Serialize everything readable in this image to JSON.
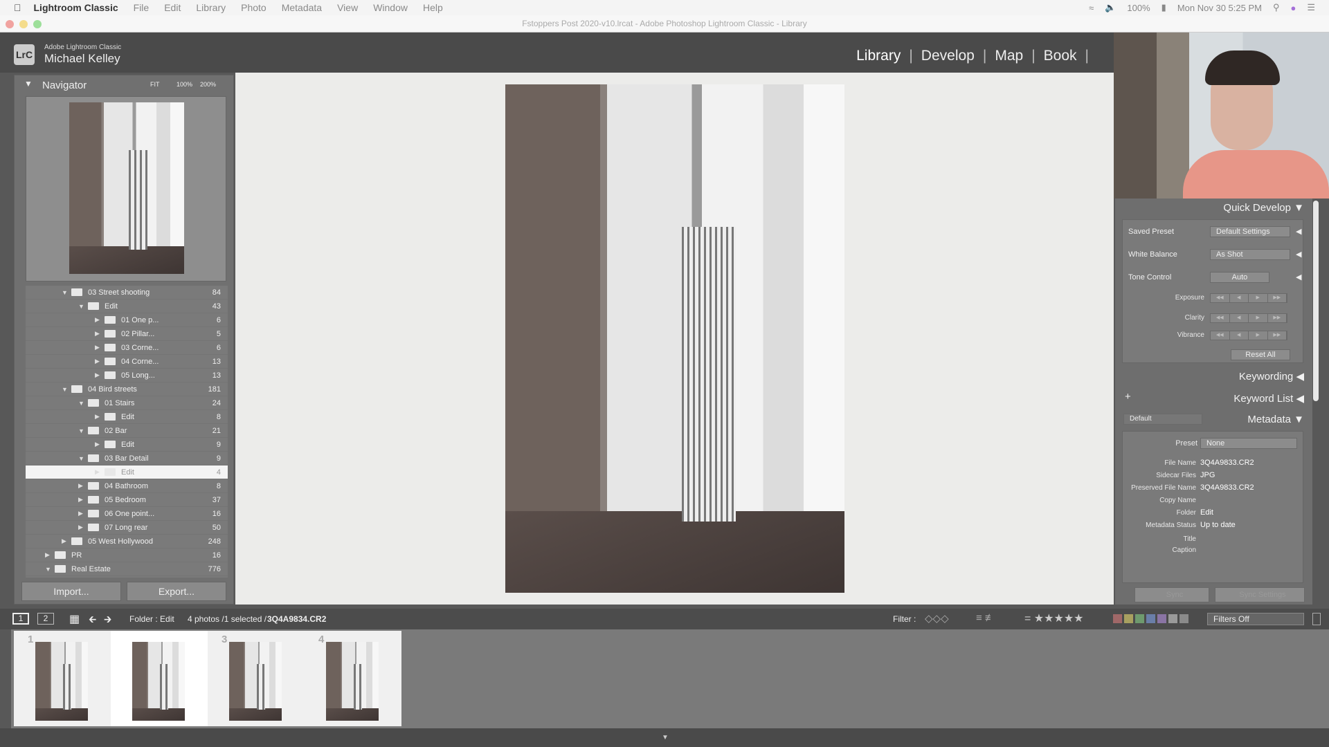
{
  "menubar": {
    "app": "Lightroom Classic",
    "items": [
      "File",
      "Edit",
      "Library",
      "Photo",
      "Metadata",
      "View",
      "Window",
      "Help"
    ],
    "battery": "100%",
    "clock": "Mon Nov 30  5:25 PM"
  },
  "window": {
    "title": "Fstoppers Post 2020-v10.lrcat - Adobe Photoshop Lightroom Classic - Library"
  },
  "header": {
    "logo": "LrC",
    "product": "Adobe Lightroom Classic",
    "user": "Michael Kelley",
    "modules": [
      "Library",
      "Develop",
      "Map",
      "Book"
    ]
  },
  "navigator": {
    "title": "Navigator",
    "zoom": [
      "FIT",
      "100%",
      "200%"
    ]
  },
  "folders": [
    {
      "name": "03 Street shooting",
      "count": "84",
      "level": 3,
      "expanded": true
    },
    {
      "name": "Edit",
      "count": "43",
      "level": 4,
      "expanded": true
    },
    {
      "name": "01 One p...",
      "count": "6",
      "level": 5,
      "expanded": false
    },
    {
      "name": "02 Pillar...",
      "count": "5",
      "level": 5,
      "expanded": false
    },
    {
      "name": "03 Corne...",
      "count": "6",
      "level": 5,
      "expanded": false
    },
    {
      "name": "04 Corne...",
      "count": "13",
      "level": 5,
      "expanded": false
    },
    {
      "name": "05 Long...",
      "count": "13",
      "level": 5,
      "expanded": false
    },
    {
      "name": "04 Bird streets",
      "count": "181",
      "level": 3,
      "expanded": true
    },
    {
      "name": "01 Stairs",
      "count": "24",
      "level": 4,
      "expanded": true
    },
    {
      "name": "Edit",
      "count": "8",
      "level": 5,
      "expanded": false
    },
    {
      "name": "02 Bar",
      "count": "21",
      "level": 4,
      "expanded": true
    },
    {
      "name": "Edit",
      "count": "9",
      "level": 5,
      "expanded": false
    },
    {
      "name": "03 Bar Detail",
      "count": "9",
      "level": 4,
      "expanded": true
    },
    {
      "name": "Edit",
      "count": "4",
      "level": 5,
      "expanded": false,
      "selected": true
    },
    {
      "name": "04 Bathroom",
      "count": "8",
      "level": 4,
      "expanded": false
    },
    {
      "name": "05 Bedroom",
      "count": "37",
      "level": 4,
      "expanded": false
    },
    {
      "name": "06 One point...",
      "count": "16",
      "level": 4,
      "expanded": false
    },
    {
      "name": "07 Long rear",
      "count": "50",
      "level": 4,
      "expanded": false
    },
    {
      "name": "05 West Hollywood",
      "count": "248",
      "level": 3,
      "expanded": false
    },
    {
      "name": "PR",
      "count": "16",
      "level": 2,
      "expanded": false
    },
    {
      "name": "Real Estate",
      "count": "776",
      "level": 2,
      "expanded": true
    }
  ],
  "left_buttons": {
    "import": "Import...",
    "export": "Export..."
  },
  "quick_develop": {
    "title": "Quick Develop",
    "saved_preset_label": "Saved Preset",
    "saved_preset": "Default Settings",
    "white_balance_label": "White Balance",
    "white_balance": "As Shot",
    "tone_control_label": "Tone Control",
    "auto": "Auto",
    "exposure": "Exposure",
    "clarity": "Clarity",
    "vibrance": "Vibrance",
    "reset": "Reset All"
  },
  "keywording": {
    "title": "Keywording"
  },
  "keyword_list": {
    "title": "Keyword List",
    "add": "+"
  },
  "metadata": {
    "title": "Metadata",
    "view": "Default",
    "preset_label": "Preset",
    "preset": "None",
    "fields": [
      {
        "label": "File Name",
        "value": "3Q4A9833.CR2"
      },
      {
        "label": "Sidecar Files",
        "value": "JPG"
      },
      {
        "label": "Preserved File Name",
        "value": "3Q4A9833.CR2"
      },
      {
        "label": "Copy Name",
        "value": ""
      },
      {
        "label": "Folder",
        "value": "Edit"
      },
      {
        "label": "Metadata Status",
        "value": "Up to date"
      },
      {
        "label": "Title",
        "value": ""
      },
      {
        "label": "Caption",
        "value": ""
      }
    ]
  },
  "sync": {
    "sync": "Sync",
    "sync_settings": "Sync Settings"
  },
  "toolbar": {
    "view1": "1",
    "view2": "2",
    "source": "Folder : Edit",
    "count": "4 photos /1 selected /",
    "filename": "3Q4A9834.CR2",
    "filter_label": "Filter :",
    "filters": "Filters Off",
    "color_labels": [
      "#a06868",
      "#a8a060",
      "#6e9a6e",
      "#6a7ea8",
      "#8a74a4",
      "#9a9a9a",
      "#8a8a8a"
    ]
  },
  "filmstrip": [
    {
      "num": "1"
    },
    {
      "num": ""
    },
    {
      "num": "3"
    },
    {
      "num": "4"
    }
  ]
}
